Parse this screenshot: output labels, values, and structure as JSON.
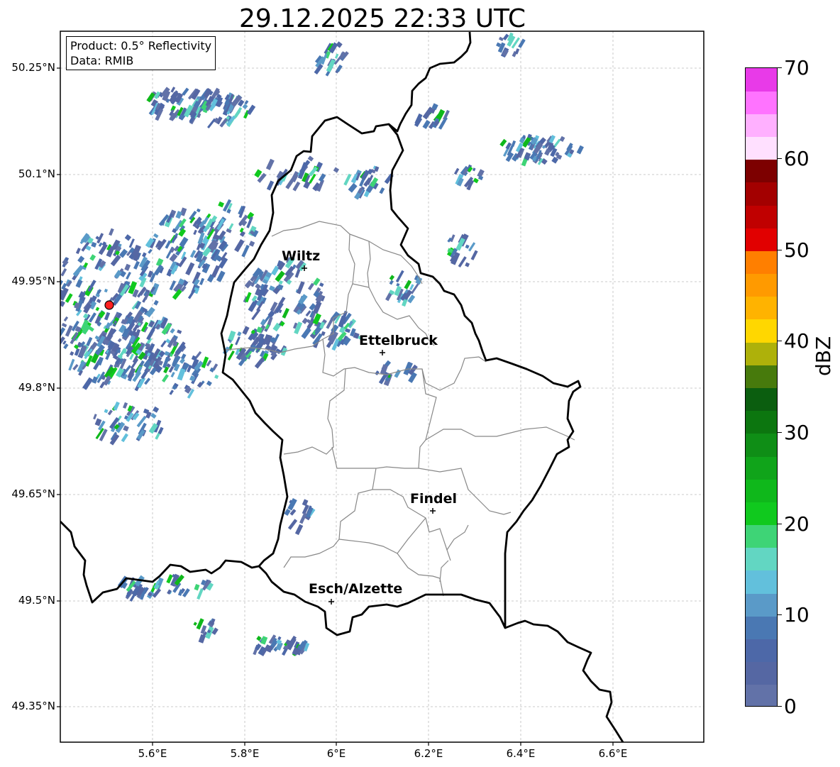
{
  "title": "29.12.2025 22:33 UTC",
  "info": {
    "product": "Product: 0.5° Reflectivity",
    "data": "Data: RMIB"
  },
  "axes": {
    "y_ticks": [
      "50.25°N",
      "50.1°N",
      "49.95°N",
      "49.8°N",
      "49.65°N",
      "49.5°N",
      "49.35°N"
    ],
    "x_ticks": [
      "5.6°E",
      "5.8°E",
      "6°E",
      "6.2°E",
      "6.4°E",
      "6.6°E"
    ]
  },
  "cities": [
    {
      "name": "Wiltz"
    },
    {
      "name": "Ettelbruck"
    },
    {
      "name": "Findel"
    },
    {
      "name": "Esch/Alzette"
    }
  ],
  "colorbar": {
    "label": "dBZ",
    "ticks": [
      "0",
      "10",
      "20",
      "30",
      "40",
      "50",
      "60",
      "70"
    ],
    "min": 0,
    "max": 70,
    "step": 2.5,
    "colors": [
      "#6272a8",
      "#5567a3",
      "#4d68a8",
      "#4a78b3",
      "#5a9ac8",
      "#62c0dc",
      "#62d6c2",
      "#3ed476",
      "#10c91e",
      "#0fb81b",
      "#10a41a",
      "#0f8e16",
      "#0c760f",
      "#0b5e0f",
      "#477a0c",
      "#aeb10a",
      "#ffd700",
      "#ffb300",
      "#ff9a00",
      "#ff7f00",
      "#e10000",
      "#c00000",
      "#a30000",
      "#7d0000",
      "#ffe0ff",
      "#ffb0ff",
      "#ff73ff",
      "#e83ae8"
    ]
  },
  "radar_site_color": "#ff2020"
}
